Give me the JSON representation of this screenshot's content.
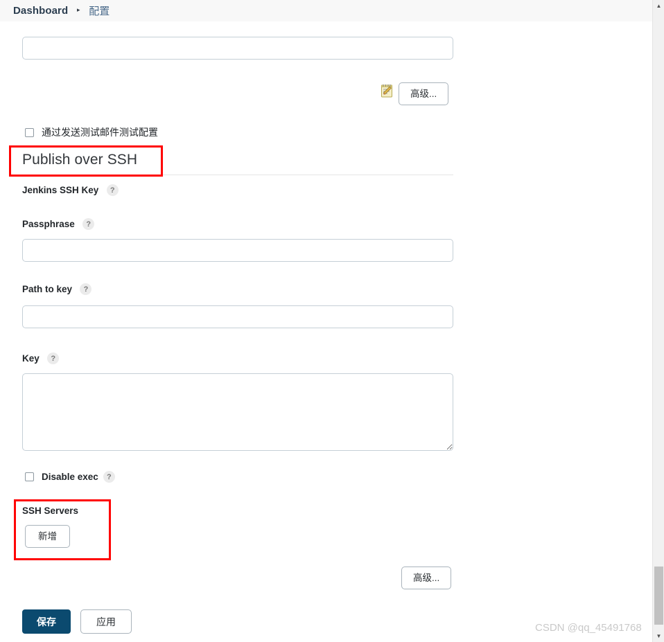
{
  "breadcrumb": {
    "root": "Dashboard",
    "separator": "▸",
    "current": "配置"
  },
  "email_section": {
    "input_value": "",
    "input_placeholder": "",
    "notepad_icon": "notepad-pencil-icon",
    "advanced_label": "高级...",
    "test_checkbox_label": "通过发送测试邮件测试配置",
    "test_checkbox_checked": false
  },
  "publish_over_ssh": {
    "title": "Publish over SSH",
    "help_glyph": "?",
    "fields": [
      {
        "label": "Jenkins SSH Key",
        "type": "header",
        "value": ""
      },
      {
        "label": "Passphrase",
        "type": "input",
        "value": ""
      },
      {
        "label": "Path to key",
        "type": "input",
        "value": ""
      },
      {
        "label": "Key",
        "type": "textarea",
        "value": ""
      }
    ],
    "disable_exec": {
      "label": "Disable exec",
      "checked": false
    },
    "ssh_servers": {
      "label": "SSH Servers",
      "add_label": "新增"
    },
    "advanced_label": "高级..."
  },
  "footer": {
    "save_label": "保存",
    "apply_label": "应用"
  },
  "scrollbar": {
    "up_glyph": "▲",
    "down_glyph": "▼"
  },
  "watermark": "CSDN @qq_45491768",
  "colors": {
    "annotation_red": "#ff0000",
    "primary_button": "#0b4a6f",
    "header_background": "#f8f8f8",
    "input_border": "#c5cfd6"
  }
}
